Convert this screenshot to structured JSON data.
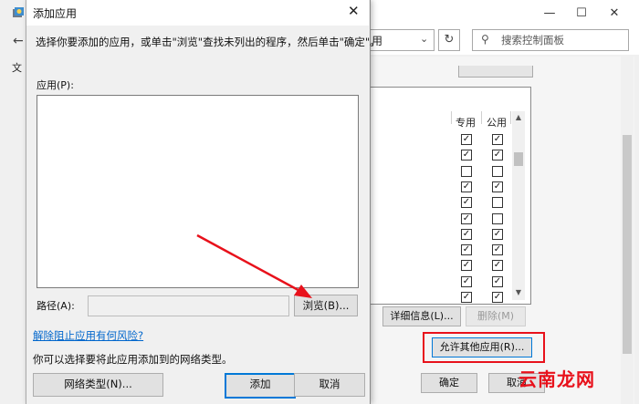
{
  "background_window": {
    "address_text": "用",
    "search_placeholder": "搜索控制面板",
    "menu_label": "文",
    "columns": {
      "private": "专用",
      "public": "公用"
    },
    "rows": [
      {
        "private": true,
        "public": true
      },
      {
        "private": true,
        "public": true
      },
      {
        "private": false,
        "public": false
      },
      {
        "private": true,
        "public": true
      },
      {
        "private": true,
        "public": false
      },
      {
        "private": true,
        "public": false
      },
      {
        "private": true,
        "public": true
      },
      {
        "private": true,
        "public": true
      },
      {
        "private": true,
        "public": true
      },
      {
        "private": true,
        "public": true
      },
      {
        "private": true,
        "public": true
      }
    ],
    "details_button": "详细信息(L)...",
    "delete_button": "删除(M)",
    "allow_other_button": "允许其他应用(R)...",
    "ok_button": "确定",
    "cancel_button": "取消"
  },
  "dialog": {
    "title": "添加应用",
    "close_glyph": "✕",
    "description": "选择你要添加的应用，或单击\"浏览\"查找未列出的程序，然后单击\"确定\"。",
    "apps_label": "应用(P):",
    "path_label": "路径(A):",
    "path_value": "",
    "browse_button": "浏览(B)...",
    "risk_link": "解除阻止应用有何风险?",
    "network_text": "你可以选择要将此应用添加到的网络类型。",
    "network_type_button": "网络类型(N)...",
    "add_button": "添加",
    "cancel_button": "取消"
  },
  "watermark": "云南龙网",
  "colors": {
    "highlight": "#e8111b",
    "link": "#0066cc",
    "focus": "#0078d7"
  }
}
